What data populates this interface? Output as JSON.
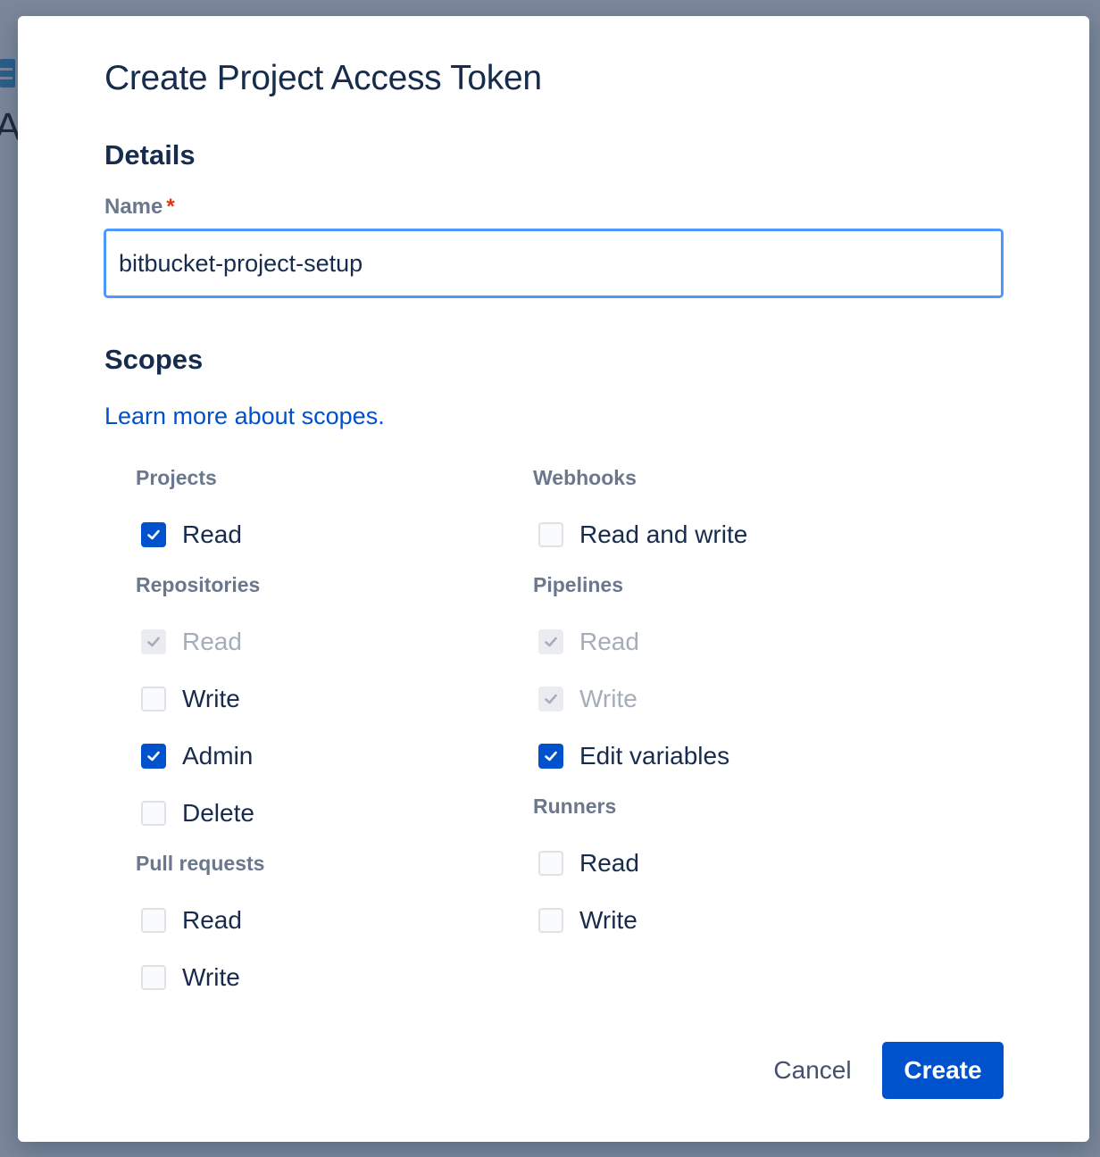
{
  "dialog": {
    "title": "Create Project Access Token",
    "details_heading": "Details",
    "name_label": "Name",
    "required_marker": "*",
    "name_value": "bitbucket-project-setup",
    "scopes_heading": "Scopes",
    "learn_more": "Learn more about scopes.",
    "cancel_label": "Cancel",
    "create_label": "Create"
  },
  "scopes": {
    "projects": {
      "label": "Projects",
      "read": {
        "label": "Read",
        "state": "checked"
      }
    },
    "repositories": {
      "label": "Repositories",
      "read": {
        "label": "Read",
        "state": "disabled-checked"
      },
      "write": {
        "label": "Write",
        "state": "unchecked"
      },
      "admin": {
        "label": "Admin",
        "state": "checked"
      },
      "delete": {
        "label": "Delete",
        "state": "unchecked"
      }
    },
    "pull_requests": {
      "label": "Pull requests",
      "read": {
        "label": "Read",
        "state": "unchecked"
      },
      "write": {
        "label": "Write",
        "state": "unchecked"
      }
    },
    "webhooks": {
      "label": "Webhooks",
      "read_write": {
        "label": "Read and write",
        "state": "unchecked"
      }
    },
    "pipelines": {
      "label": "Pipelines",
      "read": {
        "label": "Read",
        "state": "disabled-checked"
      },
      "write": {
        "label": "Write",
        "state": "disabled-checked"
      },
      "edit_variables": {
        "label": "Edit variables",
        "state": "checked"
      }
    },
    "runners": {
      "label": "Runners",
      "read": {
        "label": "Read",
        "state": "unchecked"
      },
      "write": {
        "label": "Write",
        "state": "unchecked"
      }
    }
  },
  "colors": {
    "brand": "#0052cc",
    "focus_border": "#4c9aff",
    "heading": "#172b4d",
    "muted_label": "#6b778c",
    "required": "#de350b",
    "overlay": "#7a8699"
  }
}
